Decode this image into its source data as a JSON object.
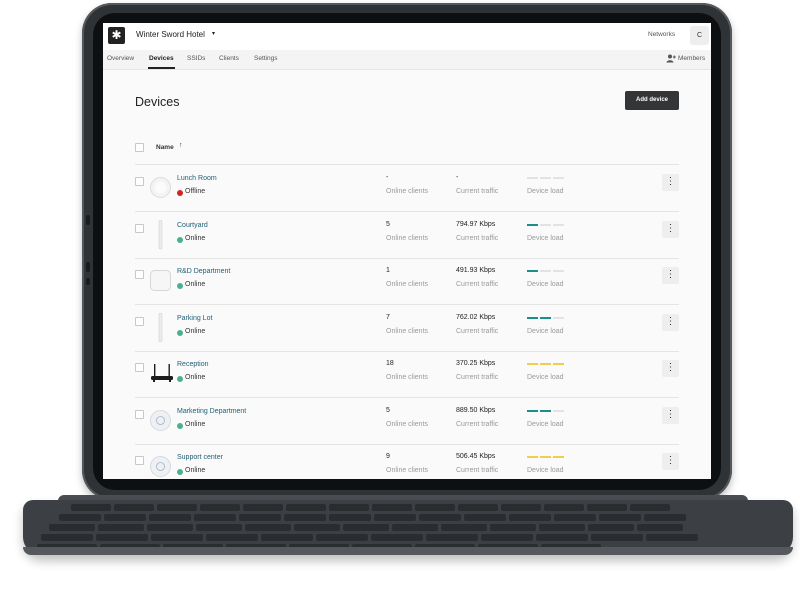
{
  "header": {
    "logo_glyph": "✱",
    "hotel_name": "Winter Sword Hotel",
    "caret": "▾",
    "networks_label": "Networks",
    "avatar_initial": "C",
    "members_label": "Members",
    "members_icon": "person-add-icon"
  },
  "tabs": [
    {
      "label": "Overview",
      "active": false
    },
    {
      "label": "Devices",
      "active": true
    },
    {
      "label": "SSIDs",
      "active": false
    },
    {
      "label": "Clients",
      "active": false
    },
    {
      "label": "Settings",
      "active": false
    }
  ],
  "page": {
    "title": "Devices",
    "add_button": "Add device",
    "column_name": "Name",
    "sort_arrow": "↑"
  },
  "colors": {
    "online": "#4bb08f",
    "offline": "#d42323",
    "load_teal": "#1a8f8c",
    "load_yellow": "#f2cc4c",
    "load_empty": "#e2e2e2",
    "link": "#1f5f75"
  },
  "devices": [
    {
      "name": "Lunch Room",
      "status": "Offline",
      "clients": "-",
      "clients_label": "Online clients",
      "traffic": "-",
      "traffic_label": "Current traffic",
      "load_label": "Device load",
      "load_segments": 0,
      "load_color": "empty",
      "thumb": "round-ap"
    },
    {
      "name": "Courtyard",
      "status": "Online",
      "clients": "5",
      "clients_label": "Online clients",
      "traffic": "794.97 Kbps",
      "traffic_label": "Current traffic",
      "load_label": "Device load",
      "load_segments": 1,
      "load_color": "teal",
      "thumb": "stick-ap"
    },
    {
      "name": "R&D Department",
      "status": "Online",
      "clients": "1",
      "clients_label": "Online clients",
      "traffic": "491.93 Kbps",
      "traffic_label": "Current traffic",
      "load_label": "Device load",
      "load_segments": 1,
      "load_color": "teal",
      "thumb": "square-ap"
    },
    {
      "name": "Parking Lot",
      "status": "Online",
      "clients": "7",
      "clients_label": "Online clients",
      "traffic": "762.02 Kbps",
      "traffic_label": "Current traffic",
      "load_label": "Device load",
      "load_segments": 2,
      "load_color": "teal",
      "thumb": "stick-ap"
    },
    {
      "name": "Reception",
      "status": "Online",
      "clients": "18",
      "clients_label": "Online clients",
      "traffic": "370.25 Kbps",
      "traffic_label": "Current traffic",
      "load_label": "Device load",
      "load_segments": 3,
      "load_color": "yellow",
      "thumb": "router"
    },
    {
      "name": "Marketing Department",
      "status": "Online",
      "clients": "5",
      "clients_label": "Online clients",
      "traffic": "889.50 Kbps",
      "traffic_label": "Current traffic",
      "load_label": "Device load",
      "load_segments": 2,
      "load_color": "teal",
      "thumb": "disc-ap"
    },
    {
      "name": "Support center",
      "status": "Online",
      "clients": "9",
      "clients_label": "Online clients",
      "traffic": "506.45 Kbps",
      "traffic_label": "Current traffic",
      "load_label": "Device load",
      "load_segments": 3,
      "load_color": "yellow",
      "thumb": "disc-ap"
    }
  ],
  "row_menu_glyph": "⋮"
}
